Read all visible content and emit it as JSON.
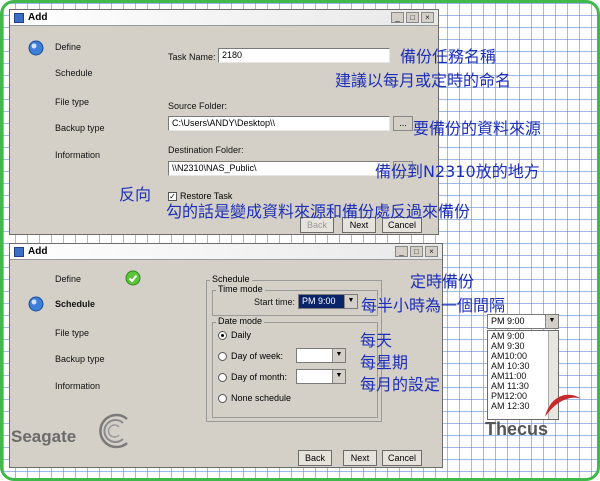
{
  "window1": {
    "title": "Add",
    "nav": [
      "Define",
      "Schedule",
      "File type",
      "Backup type",
      "Information"
    ],
    "task_name_label": "Task Name:",
    "task_name_value": "2180",
    "source_label": "Source Folder:",
    "source_value": "C:\\Users\\ANDY\\Desktop\\\\",
    "dest_label": "Destination Folder:",
    "dest_value": "\\\\N2310\\NAS_Public\\",
    "browse_label": "...",
    "restore_label": "Restore Task",
    "back": "Back",
    "next": "Next",
    "cancel": "Cancel"
  },
  "window2": {
    "title": "Add",
    "nav": [
      "Define",
      "Schedule",
      "File type",
      "Backup type",
      "Information"
    ],
    "schedule_group": "Schedule",
    "time_mode_group": "Time mode",
    "start_time_label": "Start time:",
    "start_time_value": "PM 9:00",
    "date_mode_group": "Date mode",
    "daily": "Daily",
    "day_of_week": "Day of week:",
    "day_of_month": "Day of month:",
    "none_schedule": "None schedule",
    "back": "Back",
    "next": "Next",
    "cancel": "Cancel"
  },
  "dropdown": {
    "selected": "PM 9:00",
    "items": [
      "AM 9:00",
      "AM 9:30",
      "AM10:00",
      "AM 10:30",
      "AM11:00",
      "AM 11:30",
      "PM12:00",
      "AM 12:30"
    ]
  },
  "annotations": {
    "a1": "備份任務名稱",
    "a2": "建議以每月或定時的命名",
    "a3": "要備份的資料來源",
    "a4": "備份到N2310放的地方",
    "a5": "反向",
    "a6": "勾的話是變成資料來源和備份處反過來備份",
    "a7": "定時備份",
    "a8": "每半小時為一個間隔",
    "a9": "每天",
    "a10": "每星期",
    "a11": "每月的設定"
  },
  "brands": {
    "seagate": "Seagate",
    "thecus": "Thecus"
  },
  "colors": {
    "frame_border": "#41b84a",
    "annotation": "#1d2fb8",
    "window_bg": "#d4d0c8"
  }
}
